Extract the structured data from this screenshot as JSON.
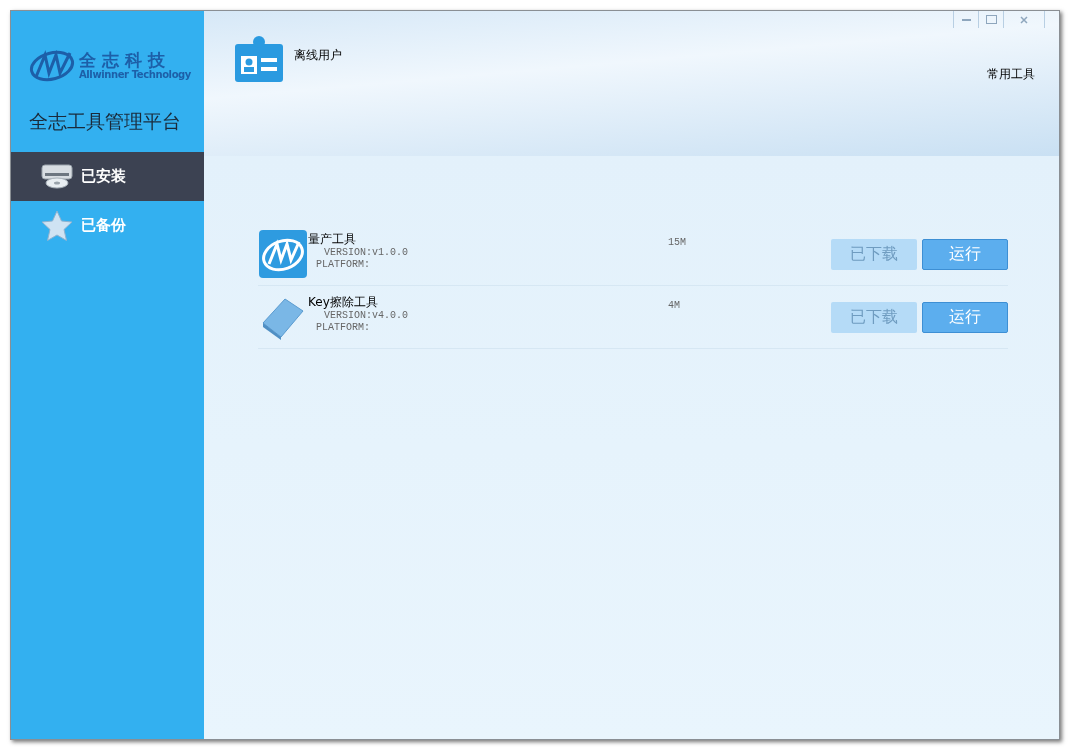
{
  "brand": {
    "name": "全 志 科 技",
    "subtitle": "Allwinner Technology"
  },
  "platform_title": "全志工具管理平台",
  "sidebar": {
    "items": [
      {
        "label": "已安装",
        "kind": "drive",
        "selected": true
      },
      {
        "label": "已备份",
        "kind": "star",
        "selected": false
      }
    ]
  },
  "header": {
    "user": "离线用户",
    "tools_link": "常用工具"
  },
  "apps": [
    {
      "name": "量产工具",
      "kind": "aw",
      "version": "VERSION:v1.0.0",
      "platform": "PLATFORM:",
      "size": "15M",
      "buttons": [
        {
          "label": "已下载",
          "disabled": true
        },
        {
          "label": "运行",
          "disabled": false
        }
      ]
    },
    {
      "name": "Key擦除工具",
      "kind": "eraser",
      "version": "VERSION:v4.0.0",
      "platform": "PLATFORM:",
      "size": "4M",
      "buttons": [
        {
          "label": "已下载",
          "disabled": true
        },
        {
          "label": "运行",
          "disabled": false
        }
      ]
    }
  ]
}
